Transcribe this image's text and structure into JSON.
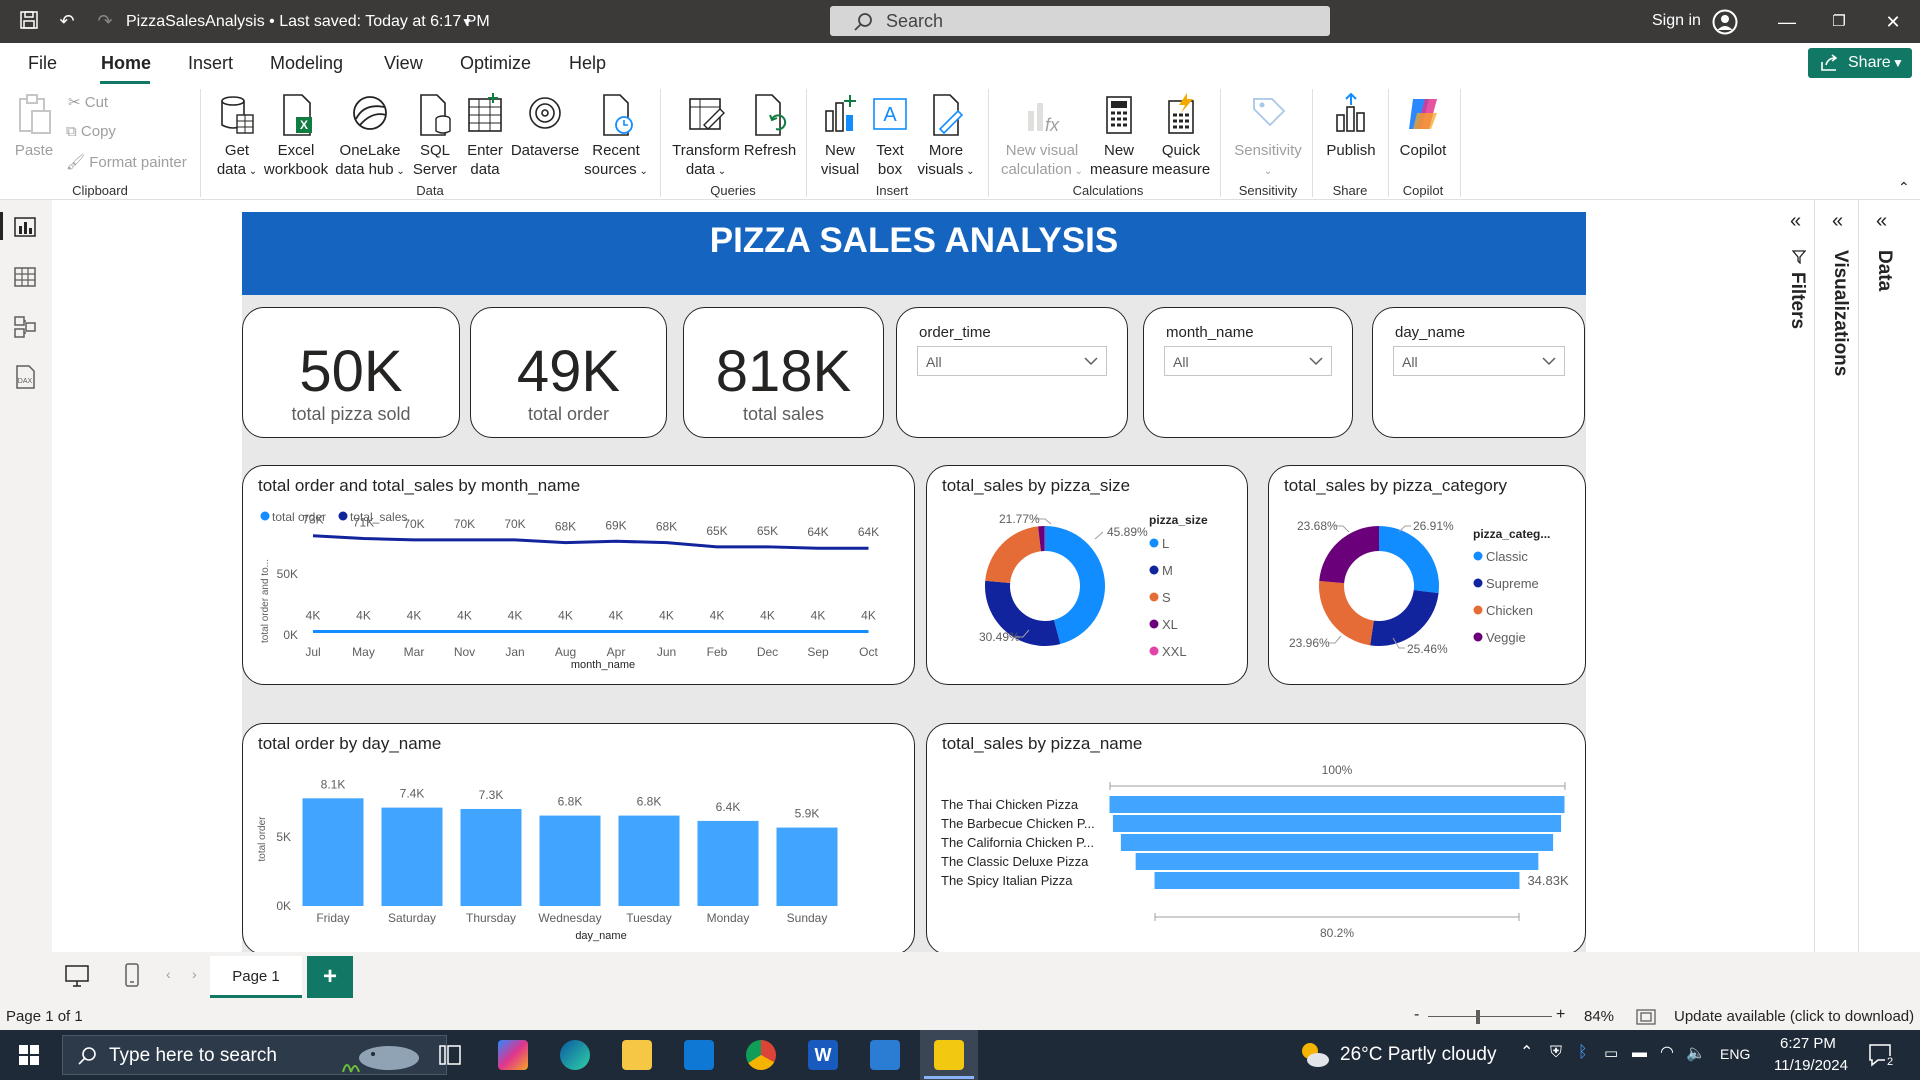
{
  "titlebar": {
    "doc_title": "PizzaSalesAnalysis  •  Last saved: Today at 6:17 PM",
    "search_placeholder": "Search",
    "signin": "Sign in"
  },
  "menu": {
    "items": [
      "File",
      "Home",
      "Insert",
      "Modeling",
      "View",
      "Optimize",
      "Help"
    ],
    "share": "Share"
  },
  "ribbon": {
    "clipboard": {
      "paste": "Paste",
      "cut": "Cut",
      "copy": "Copy",
      "format_painter": "Format painter",
      "group": "Clipboard"
    },
    "data": {
      "get_data": [
        "Get",
        "data"
      ],
      "excel": [
        "Excel",
        "workbook"
      ],
      "onelake": [
        "OneLake",
        "data hub"
      ],
      "sql": [
        "SQL",
        "Server"
      ],
      "enter": [
        "Enter",
        "data"
      ],
      "dataverse": "Dataverse",
      "recent": [
        "Recent",
        "sources"
      ],
      "group": "Data"
    },
    "queries": {
      "transform": [
        "Transform",
        "data"
      ],
      "refresh": "Refresh",
      "group": "Queries"
    },
    "insert": {
      "new_visual": [
        "New",
        "visual"
      ],
      "text_box": [
        "Text",
        "box"
      ],
      "more_visuals": [
        "More",
        "visuals"
      ],
      "group": "Insert"
    },
    "calculations": {
      "new_visual_calc": [
        "New visual",
        "calculation"
      ],
      "new_measure": [
        "New",
        "measure"
      ],
      "quick_measure": [
        "Quick",
        "measure"
      ],
      "group": "Calculations"
    },
    "sensitivity": {
      "label": "Sensitivity",
      "group": "Sensitivity"
    },
    "share": {
      "publish": "Publish",
      "group": "Share"
    },
    "copilot": {
      "label": "Copilot",
      "group": "Copilot"
    }
  },
  "report": {
    "banner": "PIZZA SALES ANALYSIS",
    "kpis": [
      {
        "value": "50K",
        "label": "total pizza sold"
      },
      {
        "value": "49K",
        "label": "total order"
      },
      {
        "value": "818K",
        "label": "total sales"
      }
    ],
    "slicers": [
      {
        "title": "order_time",
        "value": "All"
      },
      {
        "title": "month_name",
        "value": "All"
      },
      {
        "title": "day_name",
        "value": "All"
      }
    ]
  },
  "chart_data": [
    {
      "type": "line",
      "title": "total order and total_sales by month_name",
      "legend": [
        "total order",
        "total_sales"
      ],
      "xlabel": "month_name",
      "ylabel": "total order and to...",
      "yticks": [
        "50K",
        "0K"
      ],
      "categories": [
        "Jul",
        "May",
        "Mar",
        "Nov",
        "Jan",
        "Aug",
        "Apr",
        "Jun",
        "Feb",
        "Dec",
        "Sep",
        "Oct"
      ],
      "series": [
        {
          "name": "total_sales",
          "color": "#12239e",
          "values": [
            73,
            71,
            70,
            70,
            70,
            68,
            69,
            68,
            65,
            65,
            64,
            64
          ],
          "labels": [
            "73K",
            "71K",
            "70K",
            "70K",
            "70K",
            "68K",
            "69K",
            "68K",
            "65K",
            "65K",
            "64K",
            "64K"
          ]
        },
        {
          "name": "total order",
          "color": "#118dff",
          "values": [
            4,
            4,
            4,
            4,
            4,
            4,
            4,
            4,
            4,
            4,
            4,
            4
          ],
          "labels": [
            "4K",
            "4K",
            "4K",
            "4K",
            "4K",
            "4K",
            "4K",
            "4K",
            "4K",
            "4K",
            "4K",
            "4K"
          ]
        }
      ]
    },
    {
      "type": "pie",
      "title": "total_sales by pizza_size",
      "legend_title": "pizza_size",
      "slices": [
        {
          "name": "L",
          "value": 45.89,
          "color": "#118dff"
        },
        {
          "name": "M",
          "value": 30.49,
          "color": "#12239e"
        },
        {
          "name": "S",
          "value": 21.77,
          "color": "#e66c37"
        },
        {
          "name": "XL",
          "value": 1.72,
          "color": "#6b007b"
        },
        {
          "name": "XXL",
          "value": 0.12,
          "color": "#e044a7"
        }
      ],
      "data_labels": [
        "45.89%",
        "30.49%",
        "21.77%"
      ]
    },
    {
      "type": "pie",
      "title": "total_sales by pizza_category",
      "legend_title": "pizza_categ...",
      "slices": [
        {
          "name": "Classic",
          "value": 26.91,
          "color": "#118dff"
        },
        {
          "name": "Supreme",
          "value": 25.46,
          "color": "#12239e"
        },
        {
          "name": "Chicken",
          "value": 23.96,
          "color": "#e66c37"
        },
        {
          "name": "Veggie",
          "value": 23.68,
          "color": "#6b007b"
        }
      ],
      "data_labels": [
        "26.91%",
        "25.46%",
        "23.96%",
        "23.68%"
      ]
    },
    {
      "type": "bar",
      "title": "total order by day_name",
      "xlabel": "day_name",
      "ylabel": "total order",
      "yticks": [
        "5K",
        "0K"
      ],
      "categories": [
        "Friday",
        "Saturday",
        "Thursday",
        "Wednesday",
        "Tuesday",
        "Monday",
        "Sunday"
      ],
      "values": [
        8.1,
        7.4,
        7.3,
        6.8,
        6.8,
        6.4,
        5.9
      ],
      "labels": [
        "8.1K",
        "7.4K",
        "7.3K",
        "6.8K",
        "6.8K",
        "6.4K",
        "5.9K"
      ],
      "color": "#41a4ff"
    },
    {
      "type": "bar",
      "orientation": "horizontal-funnel",
      "title": "total_sales by pizza_name",
      "categories": [
        "The Thai Chicken Pizza",
        "The Barbecue Chicken P...",
        "The California Chicken P...",
        "The Classic Deluxe Pizza",
        "The Spicy Italian Pizza"
      ],
      "values": [
        100,
        98.5,
        95.0,
        88.5,
        80.2
      ],
      "top_label": "100%",
      "bottom_label": "80.2%",
      "last_value_label": "34.83K",
      "color": "#41a4ff"
    }
  ],
  "panes": {
    "filters": "Filters",
    "visualizations": "Visualizations",
    "data": "Data"
  },
  "pages": {
    "tab": "Page 1",
    "add": "+"
  },
  "status": {
    "page": "Page 1 of 1",
    "zoom": "84%",
    "update": "Update available (click to download)"
  },
  "taskbar": {
    "search_placeholder": "Type here to search",
    "weather": "26°C  Partly cloudy",
    "lang": "ENG",
    "time": "6:27 PM",
    "date": "11/19/2024",
    "notif": "2"
  }
}
